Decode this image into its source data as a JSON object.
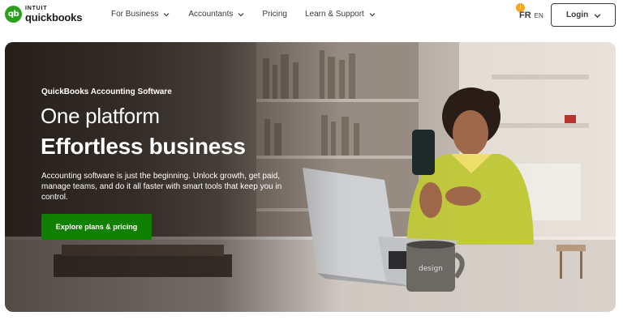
{
  "header": {
    "logo": {
      "brand": "INTUIT",
      "product": "quickbooks",
      "mark": "qb"
    },
    "nav": [
      {
        "label": "For Business",
        "icon": "chevron-down-icon"
      },
      {
        "label": "Accountants",
        "icon": "chevron-down-icon"
      },
      {
        "label": "Pricing"
      },
      {
        "label": "Learn & Support",
        "icon": "chevron-down-icon"
      }
    ],
    "language": {
      "current": "FR",
      "other": "EN",
      "badge": "!"
    },
    "login_label": "Login"
  },
  "hero": {
    "eyebrow": "QuickBooks Accounting Software",
    "headline_line1": "One platform",
    "headline_line2": "Effortless business",
    "body": "Accounting software is just the beginning. Unlock growth, get paid, manage teams, and do it all faster with smart tools that keep you in control.",
    "cta_label": "Explore plans & pricing",
    "mug_text": "design",
    "colors": {
      "cta": "#108000",
      "accent_green": "#2ca01c"
    }
  }
}
